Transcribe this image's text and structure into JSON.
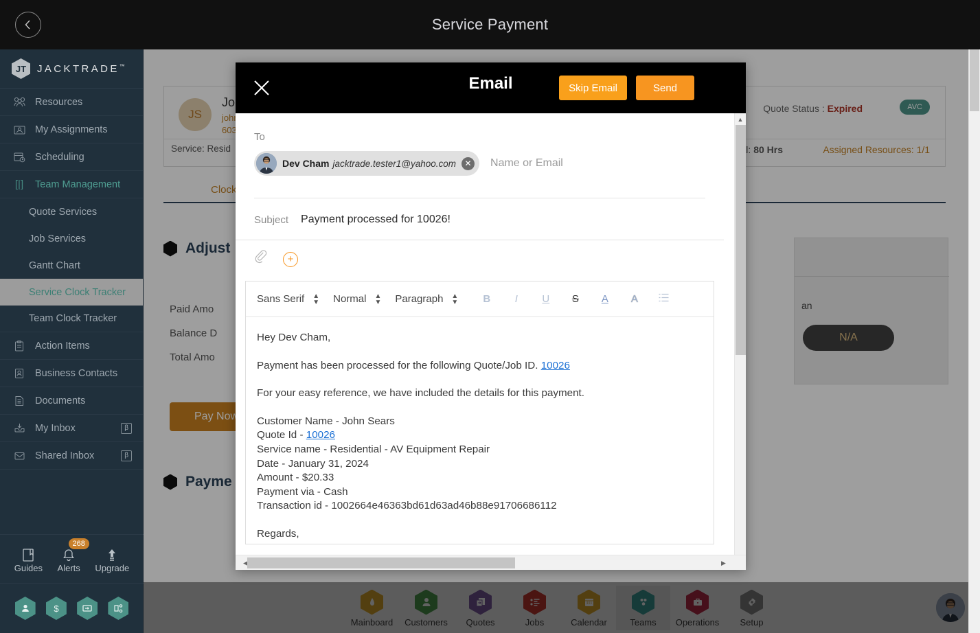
{
  "topbar": {
    "title": "Service Payment",
    "back_icon": "chevron-left-icon"
  },
  "sidebar": {
    "brand": "JACKTRADE",
    "brand_tm": "™",
    "items": [
      {
        "label": "Resources",
        "icon": "resources-icon",
        "type": "nav"
      },
      {
        "label": "My Assignments",
        "icon": "assignments-icon",
        "type": "nav"
      },
      {
        "label": "Scheduling",
        "icon": "calendar-clock-icon",
        "type": "nav"
      },
      {
        "label": "Team Management",
        "icon": "team-management-icon",
        "type": "nav",
        "active": true
      },
      {
        "label": "Quote Services",
        "type": "sub"
      },
      {
        "label": "Job Services",
        "type": "sub"
      },
      {
        "label": "Gantt Chart",
        "type": "sub"
      },
      {
        "label": "Service Clock Tracker",
        "type": "sub",
        "selected": true
      },
      {
        "label": "Team Clock Tracker",
        "type": "sub"
      },
      {
        "label": "Action Items",
        "icon": "clipboard-icon",
        "type": "nav"
      },
      {
        "label": "Business Contacts",
        "icon": "contact-card-icon",
        "type": "nav"
      },
      {
        "label": "Documents",
        "icon": "document-icon",
        "type": "nav"
      },
      {
        "label": "My Inbox",
        "icon": "inbox-icon",
        "type": "nav",
        "badge": "β"
      },
      {
        "label": "Shared Inbox",
        "icon": "envelope-icon",
        "type": "nav",
        "badge": "β"
      }
    ],
    "tools": [
      {
        "label": "Guides",
        "icon": "book-icon"
      },
      {
        "label": "Alerts",
        "icon": "bell-icon",
        "badge": "268"
      },
      {
        "label": "Upgrade",
        "icon": "up-arrow-icon"
      }
    ],
    "quick_hexes": [
      "person-icon",
      "dollar-icon",
      "money-transfer-icon",
      "workflow-icon"
    ]
  },
  "background": {
    "customer": {
      "initials": "JS",
      "name": "John",
      "email": "john",
      "phone": "603"
    },
    "service_line": "Service: Resid",
    "quote_status_label": "Quote Status :",
    "quote_status_value": "Expired",
    "avc_pill": "AVC",
    "total_hours_label": "Total:",
    "total_hours_value": "80 Hrs",
    "assigned_label": "Assigned Resources:",
    "assigned_value": "1/1",
    "clock_tab": "Clock",
    "adjust_title": "Adjust",
    "amount_rows": [
      "Paid Amo",
      "Balance D",
      "Total Amo"
    ],
    "pay_now": "Pay Now",
    "payment_title": "Payme",
    "right_panel_text": "an",
    "na_button": "N/A"
  },
  "bottom_nav": {
    "items": [
      {
        "label": "Mainboard",
        "icon": "mainboard-icon",
        "color": "#D8A72B"
      },
      {
        "label": "Customers",
        "icon": "customers-icon",
        "color": "#4E9B4E"
      },
      {
        "label": "Quotes",
        "icon": "quotes-icon",
        "color": "#7B5BA0"
      },
      {
        "label": "Jobs",
        "icon": "jobs-icon",
        "color": "#C6392F"
      },
      {
        "label": "Calendar",
        "icon": "calendar-icon",
        "color": "#D8A72B"
      },
      {
        "label": "Teams",
        "icon": "teams-icon",
        "color": "#3C9A96",
        "active": true
      },
      {
        "label": "Operations",
        "icon": "operations-icon",
        "color": "#B82A48"
      },
      {
        "label": "Setup",
        "icon": "gear-icon",
        "color": "#8A8A8A"
      }
    ],
    "avatar": "user-avatar"
  },
  "modal": {
    "title": "Email",
    "close_icon": "close-icon",
    "skip_label": "Skip Email",
    "send_label": "Send",
    "accent_color": "#F79520",
    "to_label": "To",
    "recipient": {
      "name": "Dev Cham",
      "email": "jacktrade.tester1@yahoo.com",
      "remove_icon": "remove-chip-icon"
    },
    "to_placeholder": "Name or Email",
    "subject_label": "Subject",
    "subject_value": "Payment processed for 10026!",
    "attach_icon": "paperclip-icon",
    "add_icon": "plus-circle-icon",
    "toolbar": {
      "font": "Sans Serif",
      "size": "Normal",
      "block": "Paragraph",
      "buttons": [
        {
          "label": "B",
          "name": "bold-button"
        },
        {
          "label": "I",
          "name": "italic-button"
        },
        {
          "label": "U",
          "name": "underline-button"
        },
        {
          "label": "S",
          "name": "strikethrough-button"
        },
        {
          "label": "A",
          "name": "text-color-button"
        },
        {
          "label": "A",
          "name": "highlight-color-button"
        },
        {
          "label": "☰",
          "name": "list-button"
        }
      ]
    },
    "body": {
      "greeting": "Hey Dev Cham,",
      "line_intro_pre": "Payment has been processed for the following Quote/Job ID. ",
      "line_intro_link": "10026",
      "line_reference": "For your easy reference, we have included the details for this payment.",
      "details": [
        {
          "label": "Customer Name - ",
          "value": "John Sears"
        },
        {
          "label": "Quote Id - ",
          "value": "10026",
          "link": true
        },
        {
          "label": "Service name - ",
          "value": "Residential - AV Equipment Repair"
        },
        {
          "label": "Date - ",
          "value": "January 31, 2024"
        },
        {
          "label": "Amount - ",
          "value": "$20.33"
        },
        {
          "label": "Payment via - ",
          "value": "Cash"
        },
        {
          "label": "Transaction id - ",
          "value": "1002664e46363bd61d63ad46b88e91706686112"
        }
      ],
      "regards": "Regards,"
    }
  }
}
